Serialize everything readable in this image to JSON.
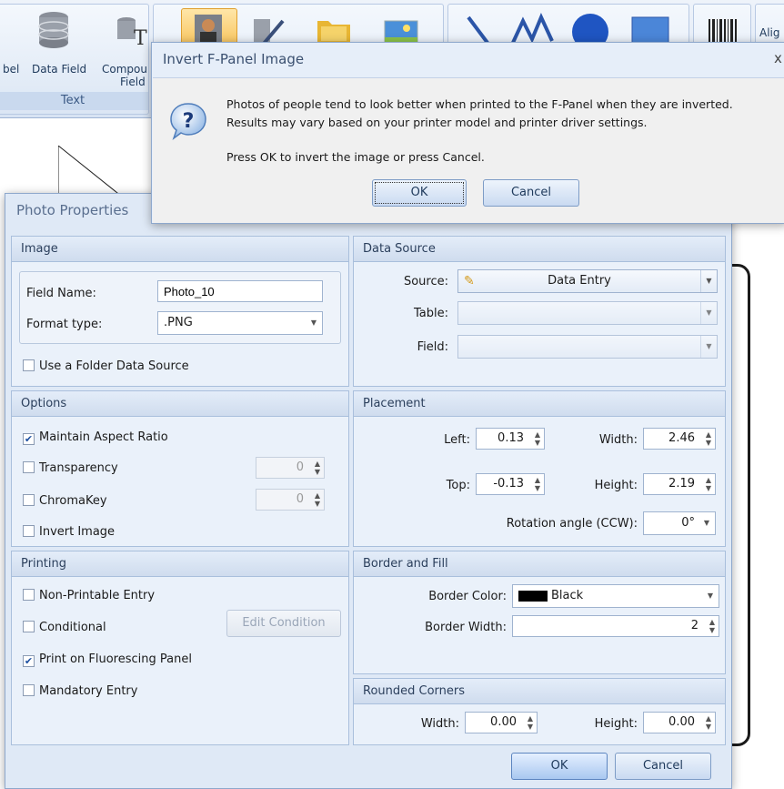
{
  "ribbon": {
    "buttons": [
      {
        "label": "bel"
      },
      {
        "label": "Data Field"
      },
      {
        "label": "Compou\nField"
      }
    ],
    "group_label": "Text",
    "align_label": "Alig"
  },
  "invert_dialog": {
    "title": "Invert F-Panel Image",
    "close": "x",
    "message_line1": "Photos of people tend to look better when printed to the F-Panel when they are inverted.",
    "message_line2": "Results may vary based on your printer model and printer driver settings.",
    "message_line3": "Press OK to invert the image or press Cancel.",
    "ok_label": "OK",
    "cancel_label": "Cancel"
  },
  "photo": {
    "title": "Photo Properties",
    "image": {
      "header": "Image",
      "field_name_label": "Field Name:",
      "field_name_value": "Photo_10",
      "format_label": "Format type:",
      "format_value": ".PNG",
      "use_folder_label": "Use a Folder Data Source"
    },
    "data_source": {
      "header": "Data Source",
      "source_label": "Source:",
      "source_value": "Data Entry",
      "table_label": "Table:",
      "field_label": "Field:"
    },
    "options": {
      "header": "Options",
      "maintain_aspect": "Maintain Aspect Ratio",
      "transparency": "Transparency",
      "transparency_value": "0",
      "chromakey": "ChromaKey",
      "chromakey_value": "0",
      "invert_image": "Invert Image"
    },
    "placement": {
      "header": "Placement",
      "left_label": "Left:",
      "left_value": "0.13",
      "width_label": "Width:",
      "width_value": "2.46",
      "top_label": "Top:",
      "top_value": "-0.13",
      "height_label": "Height:",
      "height_value": "2.19",
      "rotation_label": "Rotation angle (CCW):",
      "rotation_value": "0°"
    },
    "printing": {
      "header": "Printing",
      "non_printable": "Non-Printable Entry",
      "conditional": "Conditional",
      "edit_condition": "Edit Condition",
      "print_fluorescing": "Print on Fluorescing Panel",
      "mandatory": "Mandatory Entry"
    },
    "border_fill": {
      "header": "Border and Fill",
      "border_color_label": "Border Color:",
      "border_color_value": "Black",
      "border_width_label": "Border Width:",
      "border_width_value": "2"
    },
    "rounded": {
      "header": "Rounded Corners",
      "width_label": "Width:",
      "width_value": "0.00",
      "height_label": "Height:",
      "height_value": "0.00"
    },
    "ok_label": "OK",
    "cancel_label": "Cancel"
  },
  "colors": {
    "accent": "#1c4fa0",
    "border_black": "#000000"
  }
}
